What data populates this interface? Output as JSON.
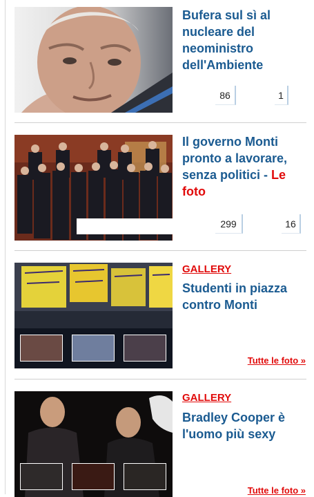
{
  "articles": [
    {
      "title": "Bufera sul sì al nucleare del neoministro dell'Ambiente",
      "count_a": "86",
      "count_b": "1"
    },
    {
      "title": "Il governo Monti pronto a lavorare, senza politici - ",
      "title_link": "Le foto",
      "count_a": "299",
      "count_b": "16"
    }
  ],
  "galleries": [
    {
      "label": "GALLERY",
      "title": "Studenti in piazza contro Monti",
      "all_photos": "Tutte le foto »"
    },
    {
      "label": "GALLERY",
      "title": "Bradley Cooper è l'uomo più sexy",
      "all_photos": "Tutte le foto »"
    }
  ]
}
